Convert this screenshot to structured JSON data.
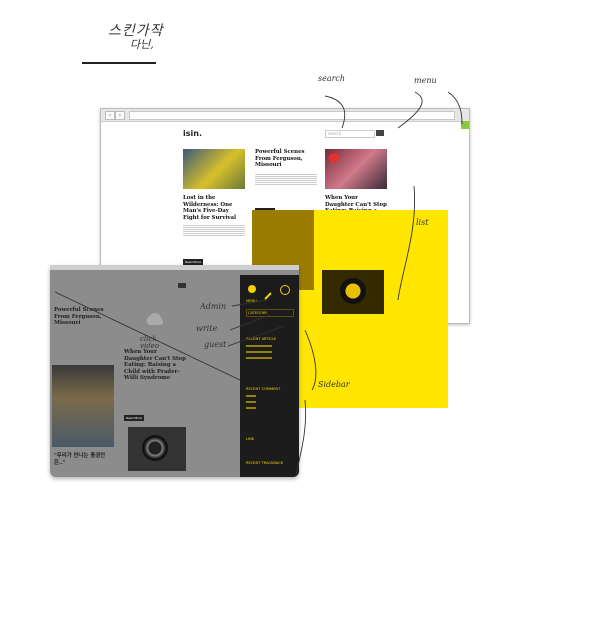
{
  "heading": {
    "title": "스킨가작",
    "subtitle": "다닌,"
  },
  "annotations": {
    "search": "search",
    "menu": "menu",
    "list": "list",
    "admin": "Admin",
    "write": "write",
    "guest": "guest",
    "sidebar": "Sidebar",
    "click_video": "click video"
  },
  "browser1": {
    "logo": "isin.",
    "search_placeholder": "search",
    "posts": [
      {
        "title": "Lost in the Wilderness: One Man's Five-Day Fight for Survival",
        "more": "Read More"
      },
      {
        "title": "Powerful Scenes From Ferguson, Missouri",
        "more": "Read More"
      },
      {
        "title": "When Your Daughter Can't Stop Eating: Raising a Child with Prader-Willi Syndrome",
        "more": "Read More"
      }
    ]
  },
  "browser2": {
    "posts": [
      {
        "title": "Powerful Scenes From Ferguson, Missouri",
        "more": "Read More"
      },
      {
        "title": "When Your Daughter Can't Stop Eating: Raising a Child with Prader-Willi Syndrome",
        "more": "Read More"
      },
      {
        "title": "\"우리가 만나는 풍경안은..\""
      }
    ],
    "drawer": {
      "menu_label": "MENU",
      "category_label": "CATEGORY",
      "recent_article": "RECENT ARTICLE",
      "recent_comment": "RECENT COMMENT",
      "link": "LINK",
      "recent_trackback": "RECENT TRACKBACK"
    }
  },
  "colors": {
    "accent_yellow": "#ffe600",
    "menu_green": "#8dc63f",
    "drawer_bg": "#1c1c1c"
  }
}
